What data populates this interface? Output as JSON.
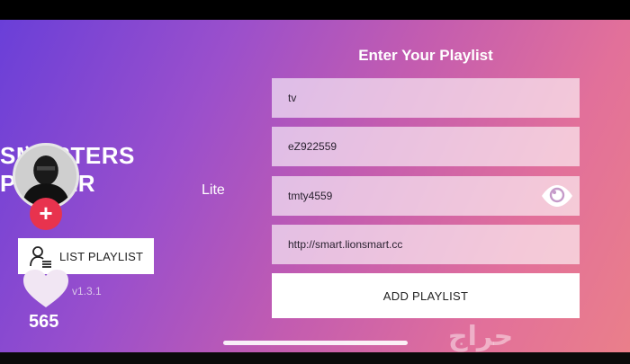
{
  "app": {
    "logo_text": "SMARTERS PLAYER",
    "logo_sub": "Lite",
    "version": "v1.3.1",
    "favorite_count": "565",
    "add_badge": "+"
  },
  "sidebar": {
    "list_playlist_label": "LIST PLAYLIST"
  },
  "form": {
    "title": "Enter Your Playlist",
    "name_value": "tv",
    "username_value": "eZ922559",
    "password_value": "tmty4559",
    "url_value": "http://smart.lionsmart.cc",
    "add_button_label": "ADD PLAYLIST"
  },
  "watermark": "حراج",
  "icons": [
    "tv-antenna-icon",
    "avatar-icon",
    "plus-icon",
    "user-list-icon",
    "heart-icon",
    "eye-icon"
  ],
  "colors": {
    "gradient_start": "#6a3fd8",
    "gradient_end": "#ea7f8a",
    "badge_red": "#e8334e"
  }
}
